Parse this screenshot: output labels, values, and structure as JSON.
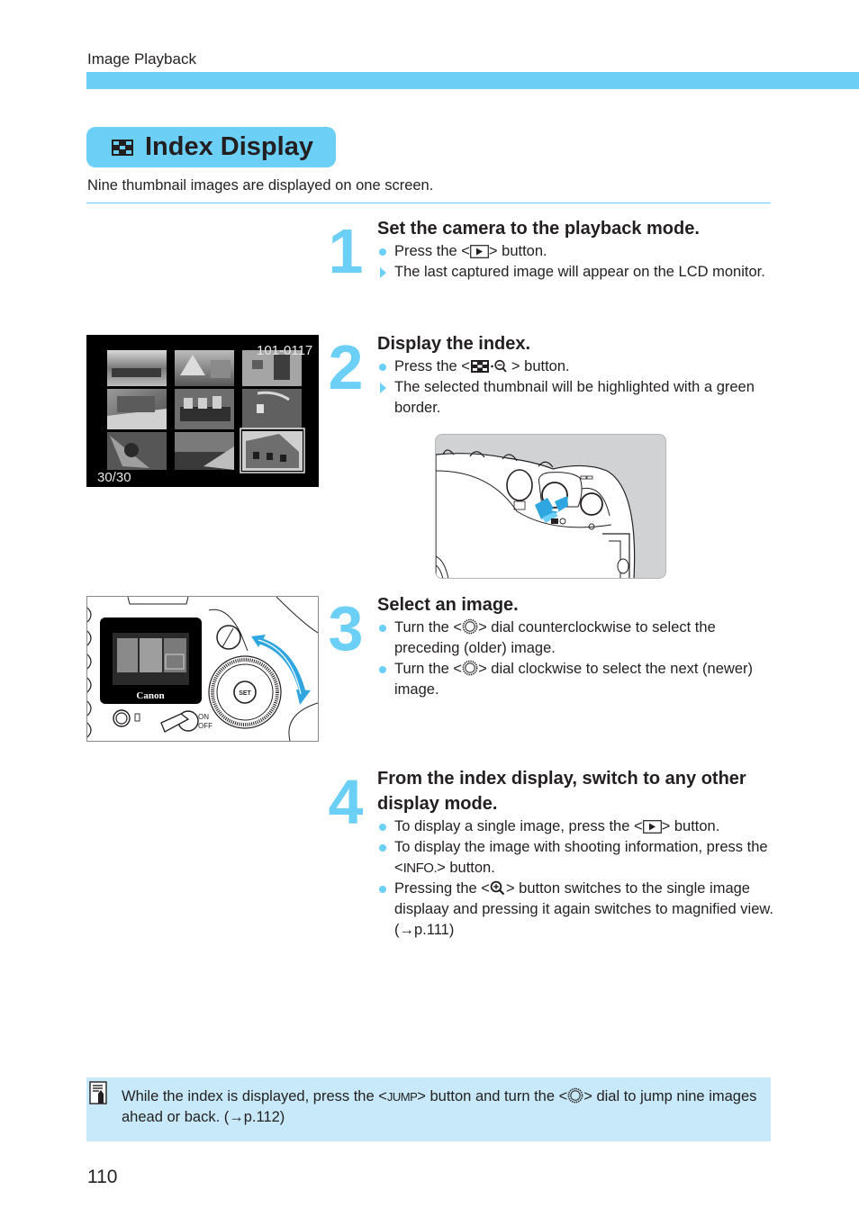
{
  "header": {
    "section_label": "Image Playback",
    "accent_color": "#6bcff6"
  },
  "title": {
    "icon": "index-grid-icon",
    "text": "Index Display"
  },
  "intro": "Nine thumbnail images are displayed on one screen.",
  "steps": [
    {
      "number": "1",
      "title": "Set the camera to the playback mode.",
      "items": [
        {
          "type": "action",
          "pre": "Press the <",
          "icon": "playback-button-icon",
          "post": "> button."
        },
        {
          "type": "result",
          "text": "The last captured image will appear on the LCD monitor."
        }
      ]
    },
    {
      "number": "2",
      "title": "Display the index.",
      "items": [
        {
          "type": "action",
          "pre": "Press the <",
          "icon": "index-reduce-button-icon",
          "post": "> button."
        },
        {
          "type": "result",
          "text": "The selected thumbnail will be highlighted with a green border."
        }
      ]
    },
    {
      "number": "3",
      "title": "Select an image.",
      "items": [
        {
          "type": "action",
          "pre": "Turn the <",
          "icon": "quick-control-dial-icon",
          "post": "> dial counterclockwise to select the preceding (older) image."
        },
        {
          "type": "action",
          "pre": "Turn the <",
          "icon": "quick-control-dial-icon",
          "post": "> dial clockwise to select the next (newer) image."
        }
      ]
    },
    {
      "number": "4",
      "title": "From the index display, switch to any other display mode.",
      "items": [
        {
          "type": "action",
          "pre": "To display a single image, press the <",
          "icon": "playback-button-icon",
          "post": "> button."
        },
        {
          "type": "action",
          "pre": "To display the image with shooting information, press the <",
          "glyph": "INFO.",
          "post": "> button."
        },
        {
          "type": "action",
          "pre": "Pressing the <",
          "icon": "magnify-button-icon",
          "post": "> button switches to the single image displaay and pressing it again switches to magnified view. (→p.111)"
        }
      ]
    }
  ],
  "figures": {
    "lcd_index": {
      "file_number": "101-0117",
      "frame_counter": "30/30",
      "thumbnail_count": 9
    },
    "camera_top": {
      "button_label": "index-reduce-button"
    },
    "camera_back": {
      "brand": "Canon",
      "set_label": "SET",
      "switch_on": "ON",
      "switch_off": "OFF"
    }
  },
  "note": {
    "icon": "memo-pencil-icon",
    "pre": "While the index is displayed, press the <",
    "jump_glyph": "JUMP",
    "mid": "> button and turn the <",
    "dial_icon": "quick-control-dial-icon",
    "post": "> dial to jump nine images ahead or back. (→p.112)"
  },
  "page_number": "110"
}
